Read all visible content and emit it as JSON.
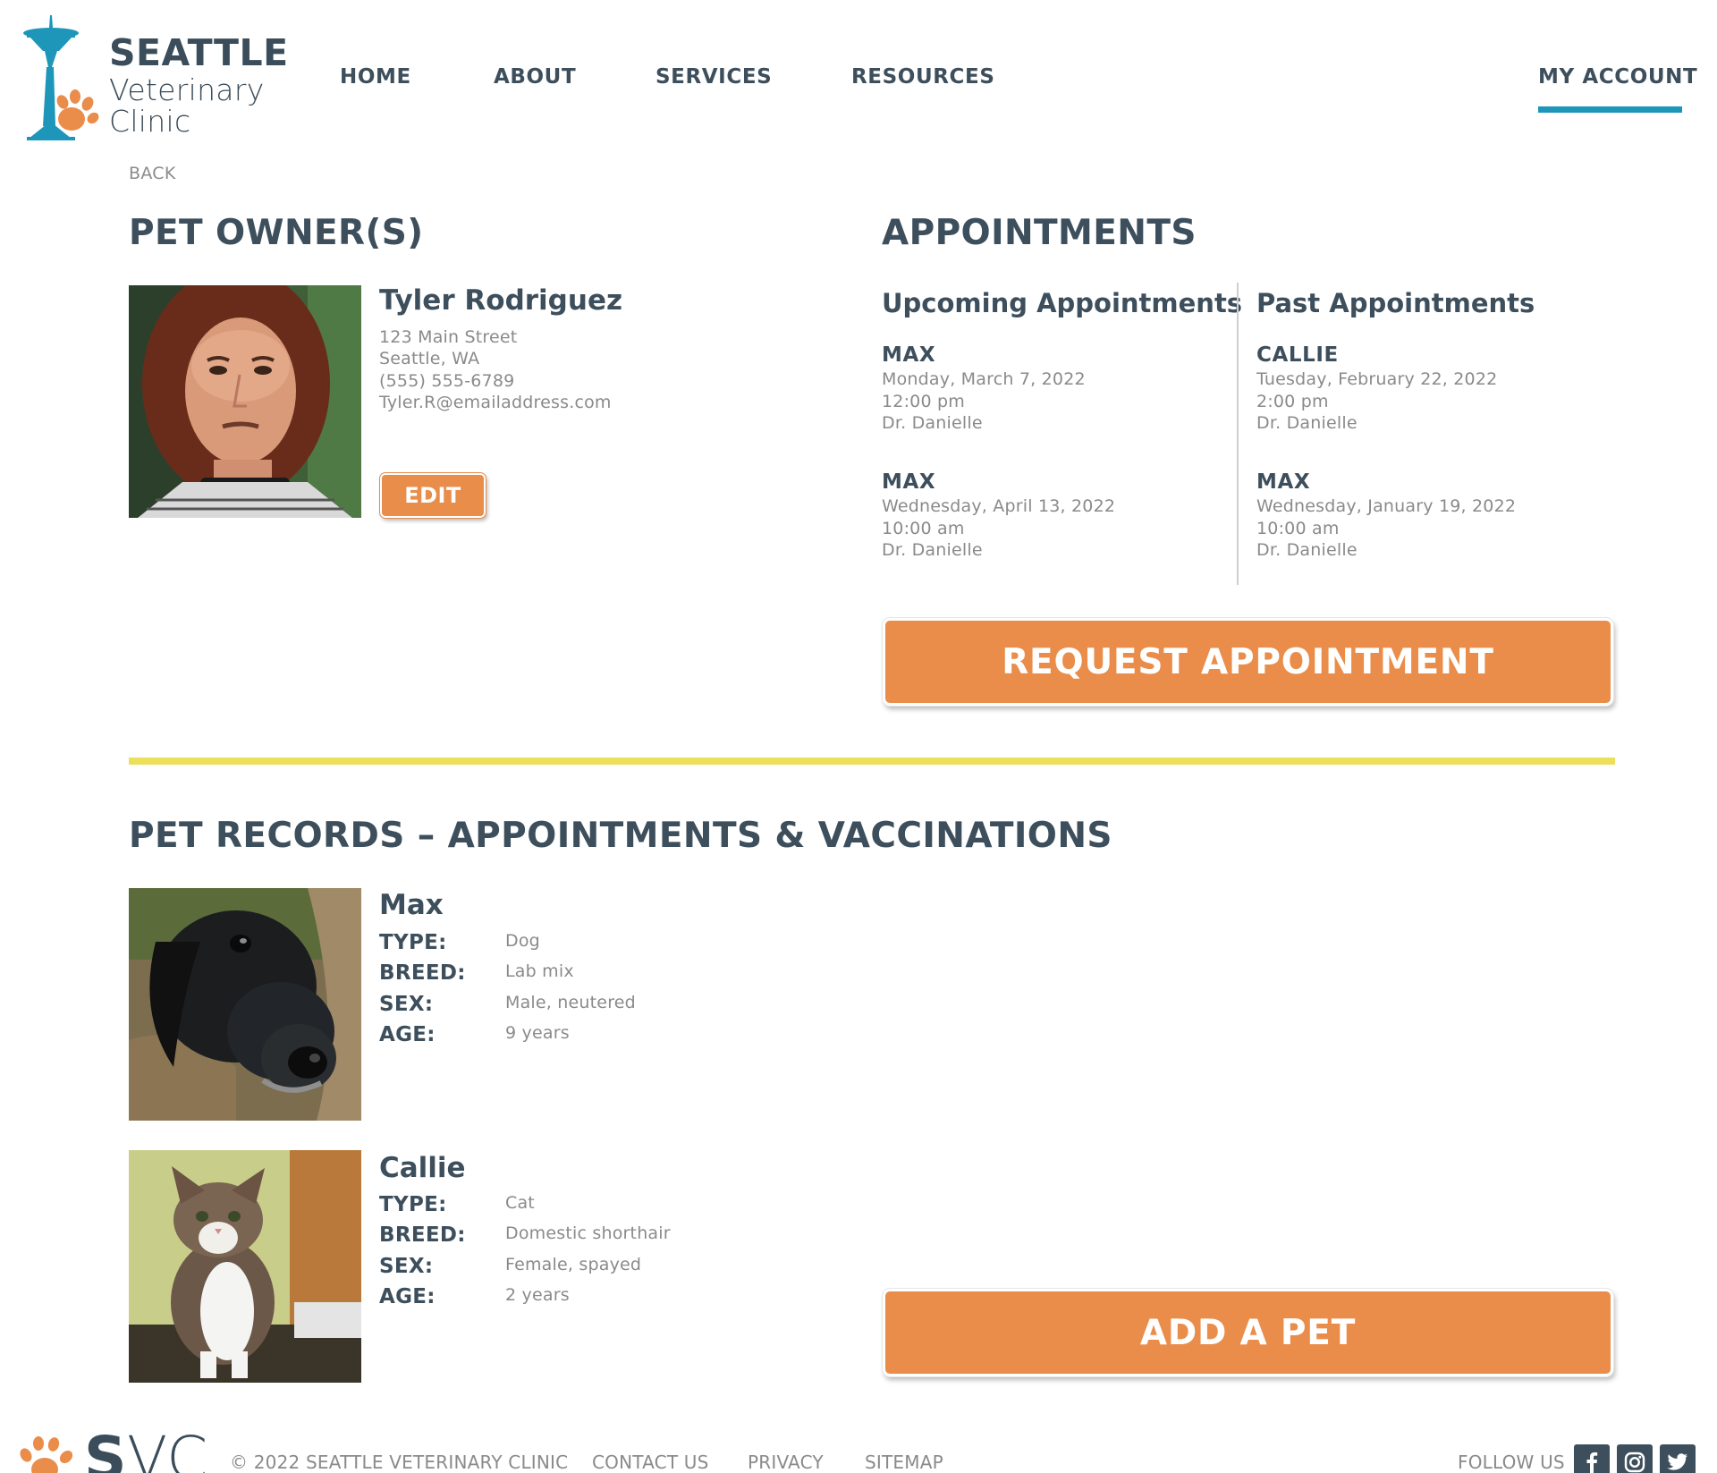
{
  "header": {
    "logo": {
      "line1": "SEATTLE",
      "line2": "Veterinary",
      "line3": "Clinic"
    },
    "nav": [
      {
        "label": "HOME"
      },
      {
        "label": "ABOUT"
      },
      {
        "label": "SERVICES"
      },
      {
        "label": "RESOURCES"
      }
    ],
    "account_label": "MY ACCOUNT"
  },
  "back_label": "BACK",
  "owner_section": {
    "heading": "PET OWNER(S)",
    "name": "Tyler Rodriguez",
    "address": "123 Main Street",
    "city": "Seattle, WA",
    "phone": "(555) 555-6789",
    "email": "Tyler.R@emailaddress.com",
    "edit_label": "EDIT"
  },
  "appointments_section": {
    "heading": "APPOINTMENTS",
    "upcoming": {
      "title": "Upcoming Appointments",
      "items": [
        {
          "pet": "MAX",
          "date": "Monday, March 7, 2022",
          "time": "12:00 pm",
          "doctor": "Dr. Danielle"
        },
        {
          "pet": "MAX",
          "date": "Wednesday, April 13, 2022",
          "time": "10:00 am",
          "doctor": "Dr. Danielle"
        }
      ]
    },
    "past": {
      "title": "Past Appointments",
      "items": [
        {
          "pet": "CALLIE",
          "date": "Tuesday, February 22, 2022",
          "time": "2:00 pm",
          "doctor": "Dr. Danielle"
        },
        {
          "pet": "MAX",
          "date": "Wednesday, January 19, 2022",
          "time": "10:00 am",
          "doctor": "Dr. Danielle"
        }
      ]
    },
    "request_label": "REQUEST APPOINTMENT"
  },
  "records_section": {
    "heading": "PET RECORDS – APPOINTMENTS & VACCINATIONS",
    "pets": [
      {
        "name": "Max",
        "fields": [
          {
            "key": "TYPE:",
            "value": "Dog"
          },
          {
            "key": "BREED:",
            "value": "Lab mix"
          },
          {
            "key": "SEX:",
            "value": "Male, neutered"
          },
          {
            "key": "AGE:",
            "value": "9 years"
          }
        ]
      },
      {
        "name": "Callie",
        "fields": [
          {
            "key": "TYPE:",
            "value": "Cat"
          },
          {
            "key": "BREED:",
            "value": "Domestic shorthair"
          },
          {
            "key": "SEX:",
            "value": "Female, spayed"
          },
          {
            "key": "AGE:",
            "value": "2 years"
          }
        ]
      }
    ],
    "add_label": "ADD A PET"
  },
  "footer": {
    "logo_s": "S",
    "logo_vc": "VC",
    "copyright": "© 2022  SEATTLE VETERINARY CLINIC",
    "links": [
      {
        "label": "CONTACT US"
      },
      {
        "label": "PRIVACY"
      },
      {
        "label": "SITEMAP"
      }
    ],
    "follow_label": "FOLLOW US",
    "social": [
      "facebook-icon",
      "instagram-icon",
      "twitter-icon"
    ]
  },
  "colors": {
    "accent_orange": "#ea8d4a",
    "accent_blue": "#1d96ba",
    "rule_yellow": "#ece05a",
    "text_dark": "#3d4f5c",
    "text_muted": "#8a8a8a"
  }
}
